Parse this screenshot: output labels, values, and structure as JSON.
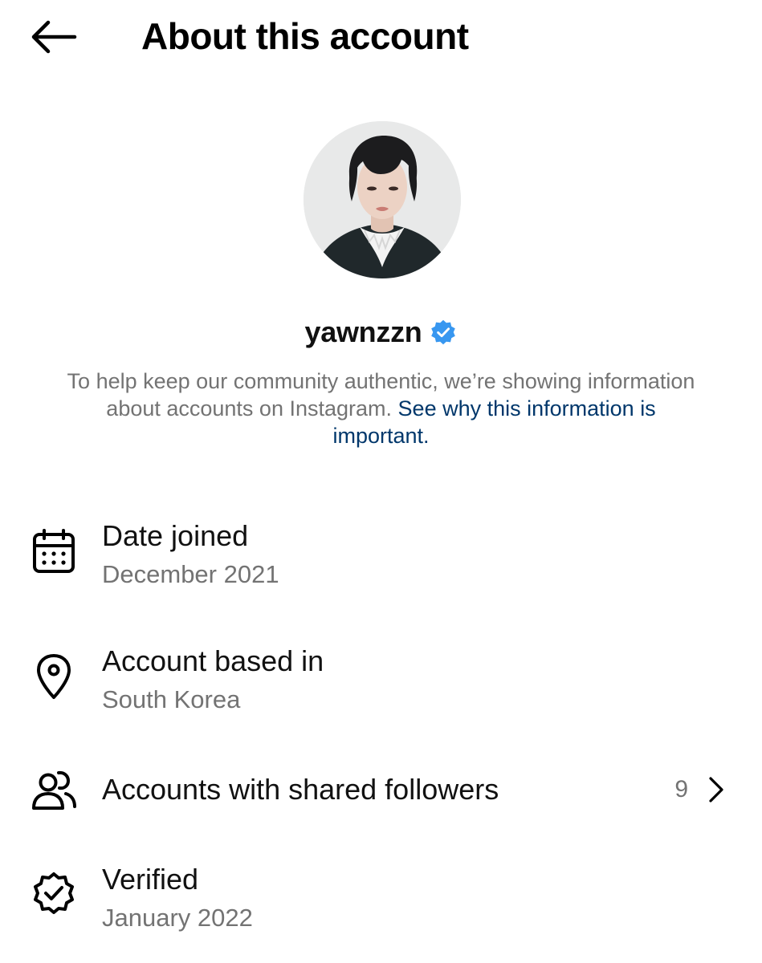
{
  "header": {
    "title": "About this account",
    "back_icon": "arrow-left-icon"
  },
  "profile": {
    "username": "yawnzzn",
    "verified_icon": "verified-badge-icon",
    "verified_color": "#3897f0",
    "info_text": "To help keep our community authentic, we’re showing information about accounts on Instagram.",
    "info_link": "See why this information is important."
  },
  "details": {
    "date_joined": {
      "icon": "calendar-icon",
      "label": "Date joined",
      "value": "December 2021"
    },
    "based_in": {
      "icon": "location-pin-icon",
      "label": "Account based in",
      "value": "South Korea"
    },
    "shared_followers": {
      "icon": "people-icon",
      "label": "Accounts with shared followers",
      "count": "9",
      "chevron_icon": "chevron-right-icon"
    },
    "verified": {
      "icon": "verified-seal-icon",
      "label": "Verified",
      "value": "January 2022"
    }
  },
  "colors": {
    "link": "#00376b",
    "secondary_text": "#737373",
    "badge_blue": "#3897f0"
  }
}
